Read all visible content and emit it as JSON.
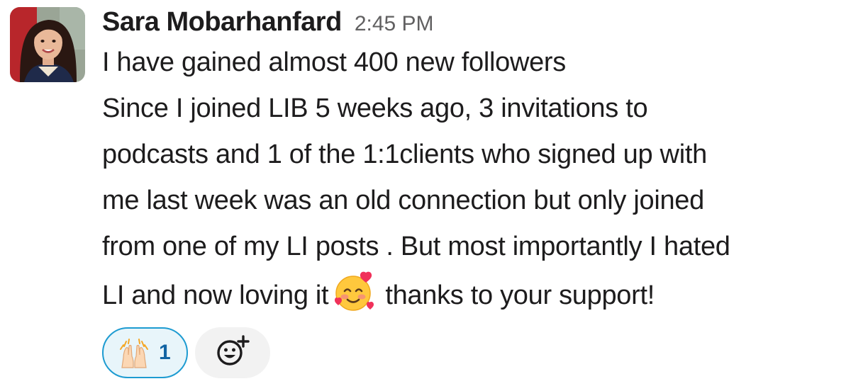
{
  "message": {
    "sender": "Sara Mobarhanfard",
    "timestamp": "2:45 PM",
    "lines": [
      "I have gained almost 400 new followers",
      "Since I joined LIB 5 weeks ago, 3 invitations to",
      "podcasts and 1 of the 1:1clients who signed up with",
      "me last week was an old connection but only joined",
      "from one of my LI posts . But most importantly I hated",
      "LI and now loving it",
      "thanks to your support!"
    ],
    "inline_emoji": "smiling-face-with-hearts-icon"
  },
  "reactions": [
    {
      "emoji": "raising-hands-icon",
      "count": "1",
      "selected": true
    }
  ],
  "add_reaction_icon": "add-reaction-icon",
  "colors": {
    "text": "#1d1c1d",
    "timestamp": "#616061",
    "reaction_border": "#1d9bd1",
    "reaction_bg": "#e8f5fa",
    "reaction_count": "#1264a3",
    "add_reaction_bg": "#f2f2f2"
  }
}
